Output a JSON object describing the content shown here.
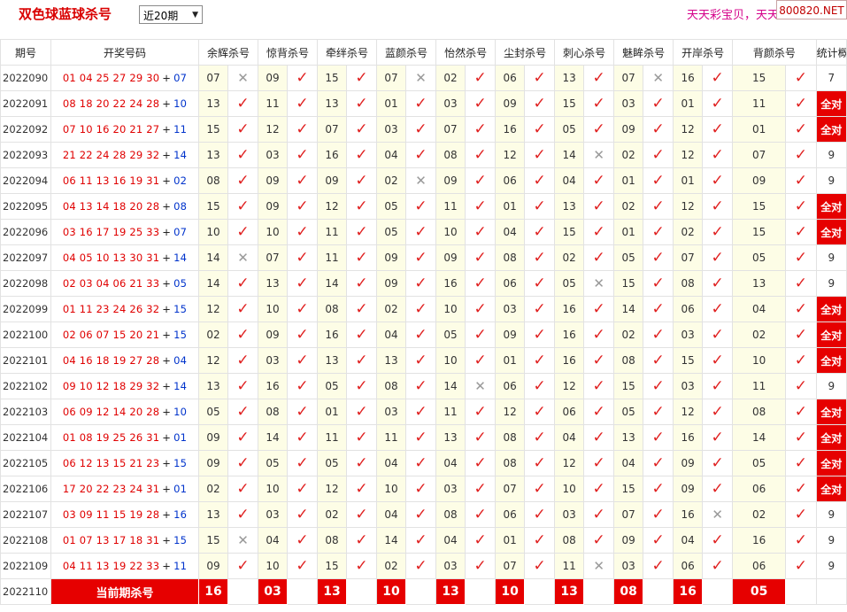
{
  "header": {
    "title": "双色球蓝球杀号",
    "period_select": {
      "selected": "近20期"
    },
    "marquee": "天天彩宝贝，天天",
    "site": "800820.NET"
  },
  "table": {
    "headers": [
      "期号",
      "开奖号码",
      "余辉杀号",
      "惊背杀号",
      "牵绊杀号",
      "蓝颜杀号",
      "怡然杀号",
      "尘封杀号",
      "刺心杀号",
      "魅眸杀号",
      "开岸杀号",
      "背颜杀号",
      "统计概况"
    ],
    "rows": [
      {
        "period": "2022090",
        "reds": "01 04 25 27 29 30",
        "blue": "07",
        "kills": [
          [
            "07",
            0
          ],
          [
            "09",
            1
          ],
          [
            "15",
            1
          ],
          [
            "07",
            0
          ],
          [
            "02",
            1
          ],
          [
            "06",
            1
          ],
          [
            "13",
            1
          ],
          [
            "07",
            0
          ],
          [
            "16",
            1
          ],
          [
            "15",
            1
          ]
        ],
        "stat": "7"
      },
      {
        "period": "2022091",
        "reds": "08 18 20 22 24 28",
        "blue": "10",
        "kills": [
          [
            "13",
            1
          ],
          [
            "11",
            1
          ],
          [
            "13",
            1
          ],
          [
            "01",
            1
          ],
          [
            "03",
            1
          ],
          [
            "09",
            1
          ],
          [
            "15",
            1
          ],
          [
            "03",
            1
          ],
          [
            "01",
            1
          ],
          [
            "11",
            1
          ]
        ],
        "stat": "全对"
      },
      {
        "period": "2022092",
        "reds": "07 10 16 20 21 27",
        "blue": "11",
        "kills": [
          [
            "15",
            1
          ],
          [
            "12",
            1
          ],
          [
            "07",
            1
          ],
          [
            "03",
            1
          ],
          [
            "07",
            1
          ],
          [
            "16",
            1
          ],
          [
            "05",
            1
          ],
          [
            "09",
            1
          ],
          [
            "12",
            1
          ],
          [
            "01",
            1
          ]
        ],
        "stat": "全对"
      },
      {
        "period": "2022093",
        "reds": "21 22 24 28 29 32",
        "blue": "14",
        "kills": [
          [
            "13",
            1
          ],
          [
            "03",
            1
          ],
          [
            "16",
            1
          ],
          [
            "04",
            1
          ],
          [
            "08",
            1
          ],
          [
            "12",
            1
          ],
          [
            "14",
            0
          ],
          [
            "02",
            1
          ],
          [
            "12",
            1
          ],
          [
            "07",
            1
          ]
        ],
        "stat": "9"
      },
      {
        "period": "2022094",
        "reds": "06 11 13 16 19 31",
        "blue": "02",
        "kills": [
          [
            "08",
            1
          ],
          [
            "09",
            1
          ],
          [
            "09",
            1
          ],
          [
            "02",
            0
          ],
          [
            "09",
            1
          ],
          [
            "06",
            1
          ],
          [
            "04",
            1
          ],
          [
            "01",
            1
          ],
          [
            "01",
            1
          ],
          [
            "09",
            1
          ]
        ],
        "stat": "9"
      },
      {
        "period": "2022095",
        "reds": "04 13 14 18 20 28",
        "blue": "08",
        "kills": [
          [
            "15",
            1
          ],
          [
            "09",
            1
          ],
          [
            "12",
            1
          ],
          [
            "05",
            1
          ],
          [
            "11",
            1
          ],
          [
            "01",
            1
          ],
          [
            "13",
            1
          ],
          [
            "02",
            1
          ],
          [
            "12",
            1
          ],
          [
            "15",
            1
          ]
        ],
        "stat": "全对"
      },
      {
        "period": "2022096",
        "reds": "03 16 17 19 25 33",
        "blue": "07",
        "kills": [
          [
            "10",
            1
          ],
          [
            "10",
            1
          ],
          [
            "11",
            1
          ],
          [
            "05",
            1
          ],
          [
            "10",
            1
          ],
          [
            "04",
            1
          ],
          [
            "15",
            1
          ],
          [
            "01",
            1
          ],
          [
            "02",
            1
          ],
          [
            "15",
            1
          ]
        ],
        "stat": "全对"
      },
      {
        "period": "2022097",
        "reds": "04 05 10 13 30 31",
        "blue": "14",
        "kills": [
          [
            "14",
            0
          ],
          [
            "07",
            1
          ],
          [
            "11",
            1
          ],
          [
            "09",
            1
          ],
          [
            "09",
            1
          ],
          [
            "08",
            1
          ],
          [
            "02",
            1
          ],
          [
            "05",
            1
          ],
          [
            "07",
            1
          ],
          [
            "05",
            1
          ]
        ],
        "stat": "9"
      },
      {
        "period": "2022098",
        "reds": "02 03 04 06 21 33",
        "blue": "05",
        "kills": [
          [
            "14",
            1
          ],
          [
            "13",
            1
          ],
          [
            "14",
            1
          ],
          [
            "09",
            1
          ],
          [
            "16",
            1
          ],
          [
            "06",
            1
          ],
          [
            "05",
            0
          ],
          [
            "15",
            1
          ],
          [
            "08",
            1
          ],
          [
            "13",
            1
          ]
        ],
        "stat": "9"
      },
      {
        "period": "2022099",
        "reds": "01 11 23 24 26 32",
        "blue": "15",
        "kills": [
          [
            "12",
            1
          ],
          [
            "10",
            1
          ],
          [
            "08",
            1
          ],
          [
            "02",
            1
          ],
          [
            "10",
            1
          ],
          [
            "03",
            1
          ],
          [
            "16",
            1
          ],
          [
            "14",
            1
          ],
          [
            "06",
            1
          ],
          [
            "04",
            1
          ]
        ],
        "stat": "全对"
      },
      {
        "period": "2022100",
        "reds": "02 06 07 15 20 21",
        "blue": "15",
        "kills": [
          [
            "02",
            1
          ],
          [
            "09",
            1
          ],
          [
            "16",
            1
          ],
          [
            "04",
            1
          ],
          [
            "05",
            1
          ],
          [
            "09",
            1
          ],
          [
            "16",
            1
          ],
          [
            "02",
            1
          ],
          [
            "03",
            1
          ],
          [
            "02",
            1
          ]
        ],
        "stat": "全对"
      },
      {
        "period": "2022101",
        "reds": "04 16 18 19 27 28",
        "blue": "04",
        "kills": [
          [
            "12",
            1
          ],
          [
            "03",
            1
          ],
          [
            "13",
            1
          ],
          [
            "13",
            1
          ],
          [
            "10",
            1
          ],
          [
            "01",
            1
          ],
          [
            "16",
            1
          ],
          [
            "08",
            1
          ],
          [
            "15",
            1
          ],
          [
            "10",
            1
          ]
        ],
        "stat": "全对"
      },
      {
        "period": "2022102",
        "reds": "09 10 12 18 29 32",
        "blue": "14",
        "kills": [
          [
            "13",
            1
          ],
          [
            "16",
            1
          ],
          [
            "05",
            1
          ],
          [
            "08",
            1
          ],
          [
            "14",
            0
          ],
          [
            "06",
            1
          ],
          [
            "12",
            1
          ],
          [
            "15",
            1
          ],
          [
            "03",
            1
          ],
          [
            "11",
            1
          ]
        ],
        "stat": "9"
      },
      {
        "period": "2022103",
        "reds": "06 09 12 14 20 28",
        "blue": "10",
        "kills": [
          [
            "05",
            1
          ],
          [
            "08",
            1
          ],
          [
            "01",
            1
          ],
          [
            "03",
            1
          ],
          [
            "11",
            1
          ],
          [
            "12",
            1
          ],
          [
            "06",
            1
          ],
          [
            "05",
            1
          ],
          [
            "12",
            1
          ],
          [
            "08",
            1
          ]
        ],
        "stat": "全对"
      },
      {
        "period": "2022104",
        "reds": "01 08 19 25 26 31",
        "blue": "01",
        "kills": [
          [
            "09",
            1
          ],
          [
            "14",
            1
          ],
          [
            "11",
            1
          ],
          [
            "11",
            1
          ],
          [
            "13",
            1
          ],
          [
            "08",
            1
          ],
          [
            "04",
            1
          ],
          [
            "13",
            1
          ],
          [
            "16",
            1
          ],
          [
            "14",
            1
          ]
        ],
        "stat": "全对"
      },
      {
        "period": "2022105",
        "reds": "06 12 13 15 21 23",
        "blue": "15",
        "kills": [
          [
            "09",
            1
          ],
          [
            "05",
            1
          ],
          [
            "05",
            1
          ],
          [
            "04",
            1
          ],
          [
            "04",
            1
          ],
          [
            "08",
            1
          ],
          [
            "12",
            1
          ],
          [
            "04",
            1
          ],
          [
            "09",
            1
          ],
          [
            "05",
            1
          ]
        ],
        "stat": "全对"
      },
      {
        "period": "2022106",
        "reds": "17 20 22 23 24 31",
        "blue": "01",
        "kills": [
          [
            "02",
            1
          ],
          [
            "10",
            1
          ],
          [
            "12",
            1
          ],
          [
            "10",
            1
          ],
          [
            "03",
            1
          ],
          [
            "07",
            1
          ],
          [
            "10",
            1
          ],
          [
            "15",
            1
          ],
          [
            "09",
            1
          ],
          [
            "06",
            1
          ]
        ],
        "stat": "全对"
      },
      {
        "period": "2022107",
        "reds": "03 09 11 15 19 28",
        "blue": "16",
        "kills": [
          [
            "13",
            1
          ],
          [
            "03",
            1
          ],
          [
            "02",
            1
          ],
          [
            "04",
            1
          ],
          [
            "08",
            1
          ],
          [
            "06",
            1
          ],
          [
            "03",
            1
          ],
          [
            "07",
            1
          ],
          [
            "16",
            0
          ],
          [
            "02",
            1
          ]
        ],
        "stat": "9"
      },
      {
        "period": "2022108",
        "reds": "01 07 13 17 18 31",
        "blue": "15",
        "kills": [
          [
            "15",
            0
          ],
          [
            "04",
            1
          ],
          [
            "08",
            1
          ],
          [
            "14",
            1
          ],
          [
            "04",
            1
          ],
          [
            "01",
            1
          ],
          [
            "08",
            1
          ],
          [
            "09",
            1
          ],
          [
            "04",
            1
          ],
          [
            "16",
            1
          ]
        ],
        "stat": "9"
      },
      {
        "period": "2022109",
        "reds": "04 11 13 19 22 33",
        "blue": "11",
        "kills": [
          [
            "09",
            1
          ],
          [
            "10",
            1
          ],
          [
            "15",
            1
          ],
          [
            "02",
            1
          ],
          [
            "03",
            1
          ],
          [
            "07",
            1
          ],
          [
            "11",
            0
          ],
          [
            "03",
            1
          ],
          [
            "06",
            1
          ],
          [
            "06",
            1
          ]
        ],
        "stat": "9"
      }
    ],
    "current": {
      "period": "2022110",
      "label": "当前期杀号",
      "kills": [
        "16",
        "03",
        "13",
        "10",
        "13",
        "10",
        "13",
        "08",
        "16",
        "05"
      ]
    }
  },
  "glyphs": {
    "check": "✓",
    "cross": "✕",
    "plus": "+",
    "caret": "▼"
  },
  "colors": {
    "red": "#e60000",
    "blue_ball": "#0033cc",
    "cell_highlight": "#fdfde6"
  }
}
